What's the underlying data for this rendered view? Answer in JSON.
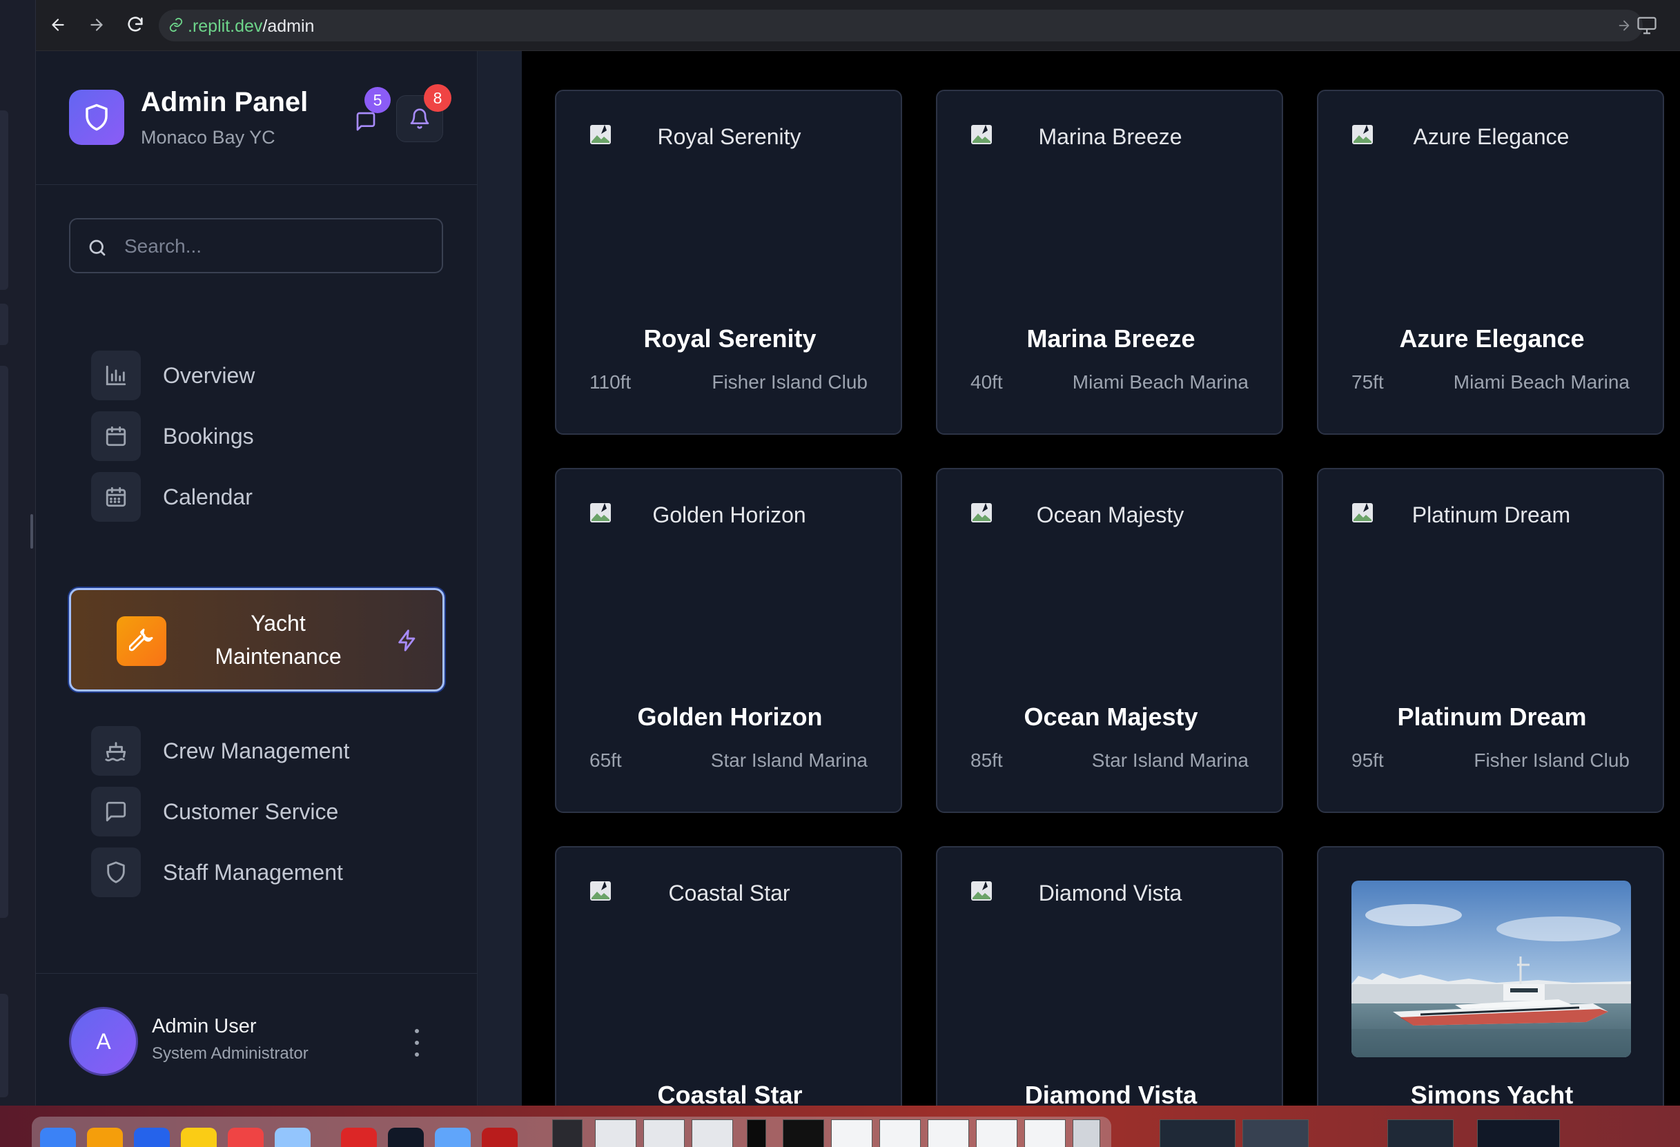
{
  "browser": {
    "url_host": ".replit.dev",
    "url_path": "/admin"
  },
  "sidebar": {
    "title": "Admin Panel",
    "subtitle": "Monaco Bay YC",
    "messages_badge": "5",
    "notifications_badge": "8",
    "search_placeholder": "Search...",
    "nav": [
      {
        "label": "Overview",
        "icon": "bar-chart-icon"
      },
      {
        "label": "Bookings",
        "icon": "calendar-icon"
      },
      {
        "label": "Calendar",
        "icon": "calendar-grid-icon"
      },
      {
        "label": "Yacht Maintenance",
        "icon": "wrench-icon",
        "active": true
      },
      {
        "label": "Crew Management",
        "icon": "ship-icon"
      },
      {
        "label": "Customer Service",
        "icon": "message-square-icon"
      },
      {
        "label": "Staff Management",
        "icon": "shield-icon"
      }
    ],
    "user": {
      "initial": "A",
      "name": "Admin User",
      "role": "System Administrator"
    }
  },
  "yachts": [
    {
      "alt": "Royal Serenity",
      "name": "Royal Serenity",
      "length": "110ft",
      "marina": "Fisher Island Club"
    },
    {
      "alt": "Marina Breeze",
      "name": "Marina Breeze",
      "length": "40ft",
      "marina": "Miami Beach Marina"
    },
    {
      "alt": "Azure Elegance",
      "name": "Azure Elegance",
      "length": "75ft",
      "marina": "Miami Beach Marina"
    },
    {
      "alt": "Golden Horizon",
      "name": "Golden Horizon",
      "length": "65ft",
      "marina": "Star Island Marina"
    },
    {
      "alt": "Ocean Majesty",
      "name": "Ocean Majesty",
      "length": "85ft",
      "marina": "Star Island Marina"
    },
    {
      "alt": "Platinum Dream",
      "name": "Platinum Dream",
      "length": "95ft",
      "marina": "Fisher Island Club"
    },
    {
      "alt": "Coastal Star",
      "name": "Coastal Star",
      "length": "",
      "marina": ""
    },
    {
      "alt": "Diamond Vista",
      "name": "Diamond Vista",
      "length": "",
      "marina": ""
    },
    {
      "alt": "",
      "name": "Simons Yacht",
      "length": "",
      "marina": "",
      "has_photo": true
    }
  ],
  "colors": {
    "accent": "#8b5cf6",
    "active_item": "#f97316",
    "badge_red": "#ef4444",
    "sidebar_bg": "#161b28",
    "card_bg": "#141a28"
  }
}
